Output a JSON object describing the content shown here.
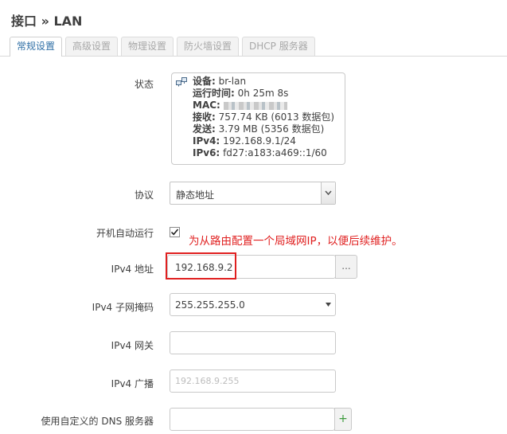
{
  "page": {
    "title": "接口 » LAN"
  },
  "tabs": [
    {
      "label": "常规设置",
      "active": true
    },
    {
      "label": "高级设置",
      "active": false
    },
    {
      "label": "物理设置",
      "active": false
    },
    {
      "label": "防火墙设置",
      "active": false
    },
    {
      "label": "DHCP 服务器",
      "active": false
    }
  ],
  "status": {
    "label": "状态",
    "device_key": "设备:",
    "device_val": "br-lan",
    "uptime_key": "运行时间:",
    "uptime_val": "0h 25m 8s",
    "mac_key": "MAC:",
    "rx_key": "接收:",
    "rx_val": "757.74 KB (6013 数据包)",
    "tx_key": "发送:",
    "tx_val": "3.79 MB (5356 数据包)",
    "ipv4_key": "IPv4:",
    "ipv4_val": "192.168.9.1/24",
    "ipv6_key": "IPv6:",
    "ipv6_val": "fd27:a183:a469::1/60"
  },
  "protocol": {
    "label": "协议",
    "value": "静态地址"
  },
  "autostart": {
    "label": "开机自动运行",
    "checked": true
  },
  "annotation": "为从路由配置一个局域网IP，以便后续维护。",
  "ipv4_addr": {
    "label": "IPv4 地址",
    "value": "192.168.9.2",
    "addon": "..."
  },
  "ipv4_mask": {
    "label": "IPv4 子网掩码",
    "value": "255.255.255.0"
  },
  "ipv4_gw": {
    "label": "IPv4 网关",
    "value": ""
  },
  "ipv4_bcast": {
    "label": "IPv4 广播",
    "placeholder": "192.168.9.255"
  },
  "dns": {
    "label": "使用自定义的 DNS 服务器",
    "value": "",
    "addon": "+"
  },
  "colors": {
    "accent": "#2f6fa6",
    "annotation": "#e02020",
    "plus": "#3c9a3c"
  }
}
